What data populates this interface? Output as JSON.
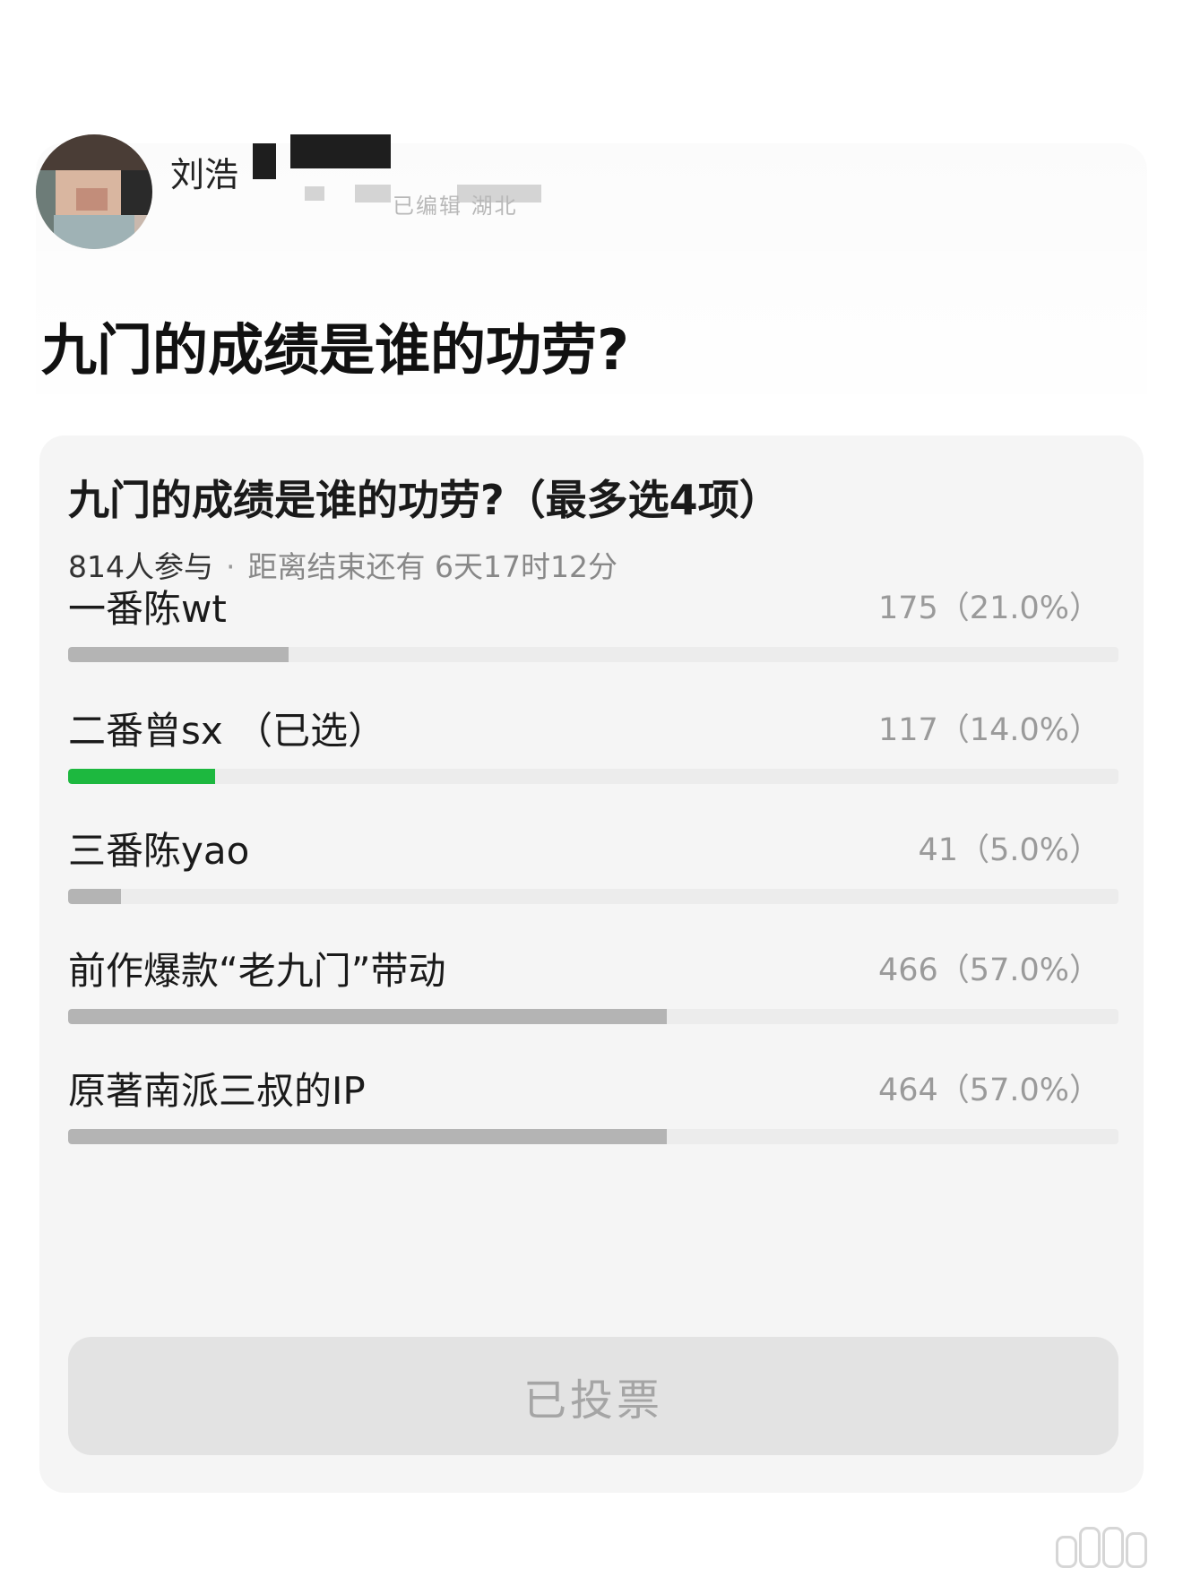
{
  "post": {
    "author_name_visible": "刘浩",
    "meta_text": "已编辑  湖北",
    "title": "九门的成绩是谁的功劳?"
  },
  "poll": {
    "title": "九门的成绩是谁的功劳?（最多选4项）",
    "participants": "814人参与",
    "separator": "·",
    "deadline": "距离结束还有 6天17时12分",
    "options": [
      {
        "label": "一番陈wt",
        "count_text": "175（21.0%）",
        "votes": 175,
        "percent": 21.0,
        "selected": false
      },
      {
        "label": "二番曾sx （已选）",
        "count_text": "117（14.0%）",
        "votes": 117,
        "percent": 14.0,
        "selected": true
      },
      {
        "label": "三番陈yao",
        "count_text": "41（5.0%）",
        "votes": 41,
        "percent": 5.0,
        "selected": false
      },
      {
        "label": "前作爆款“老九门”带动",
        "count_text": "466（57.0%）",
        "votes": 466,
        "percent": 57.0,
        "selected": false
      },
      {
        "label": "原著南派三叔的IP",
        "count_text": "464（57.0%）",
        "votes": 464,
        "percent": 57.0,
        "selected": false
      }
    ],
    "button_label": "已投票"
  },
  "colors": {
    "selected_bar": "#1db83f",
    "unselected_bar": "#b4b4b4",
    "card_bg": "#f5f5f5"
  }
}
